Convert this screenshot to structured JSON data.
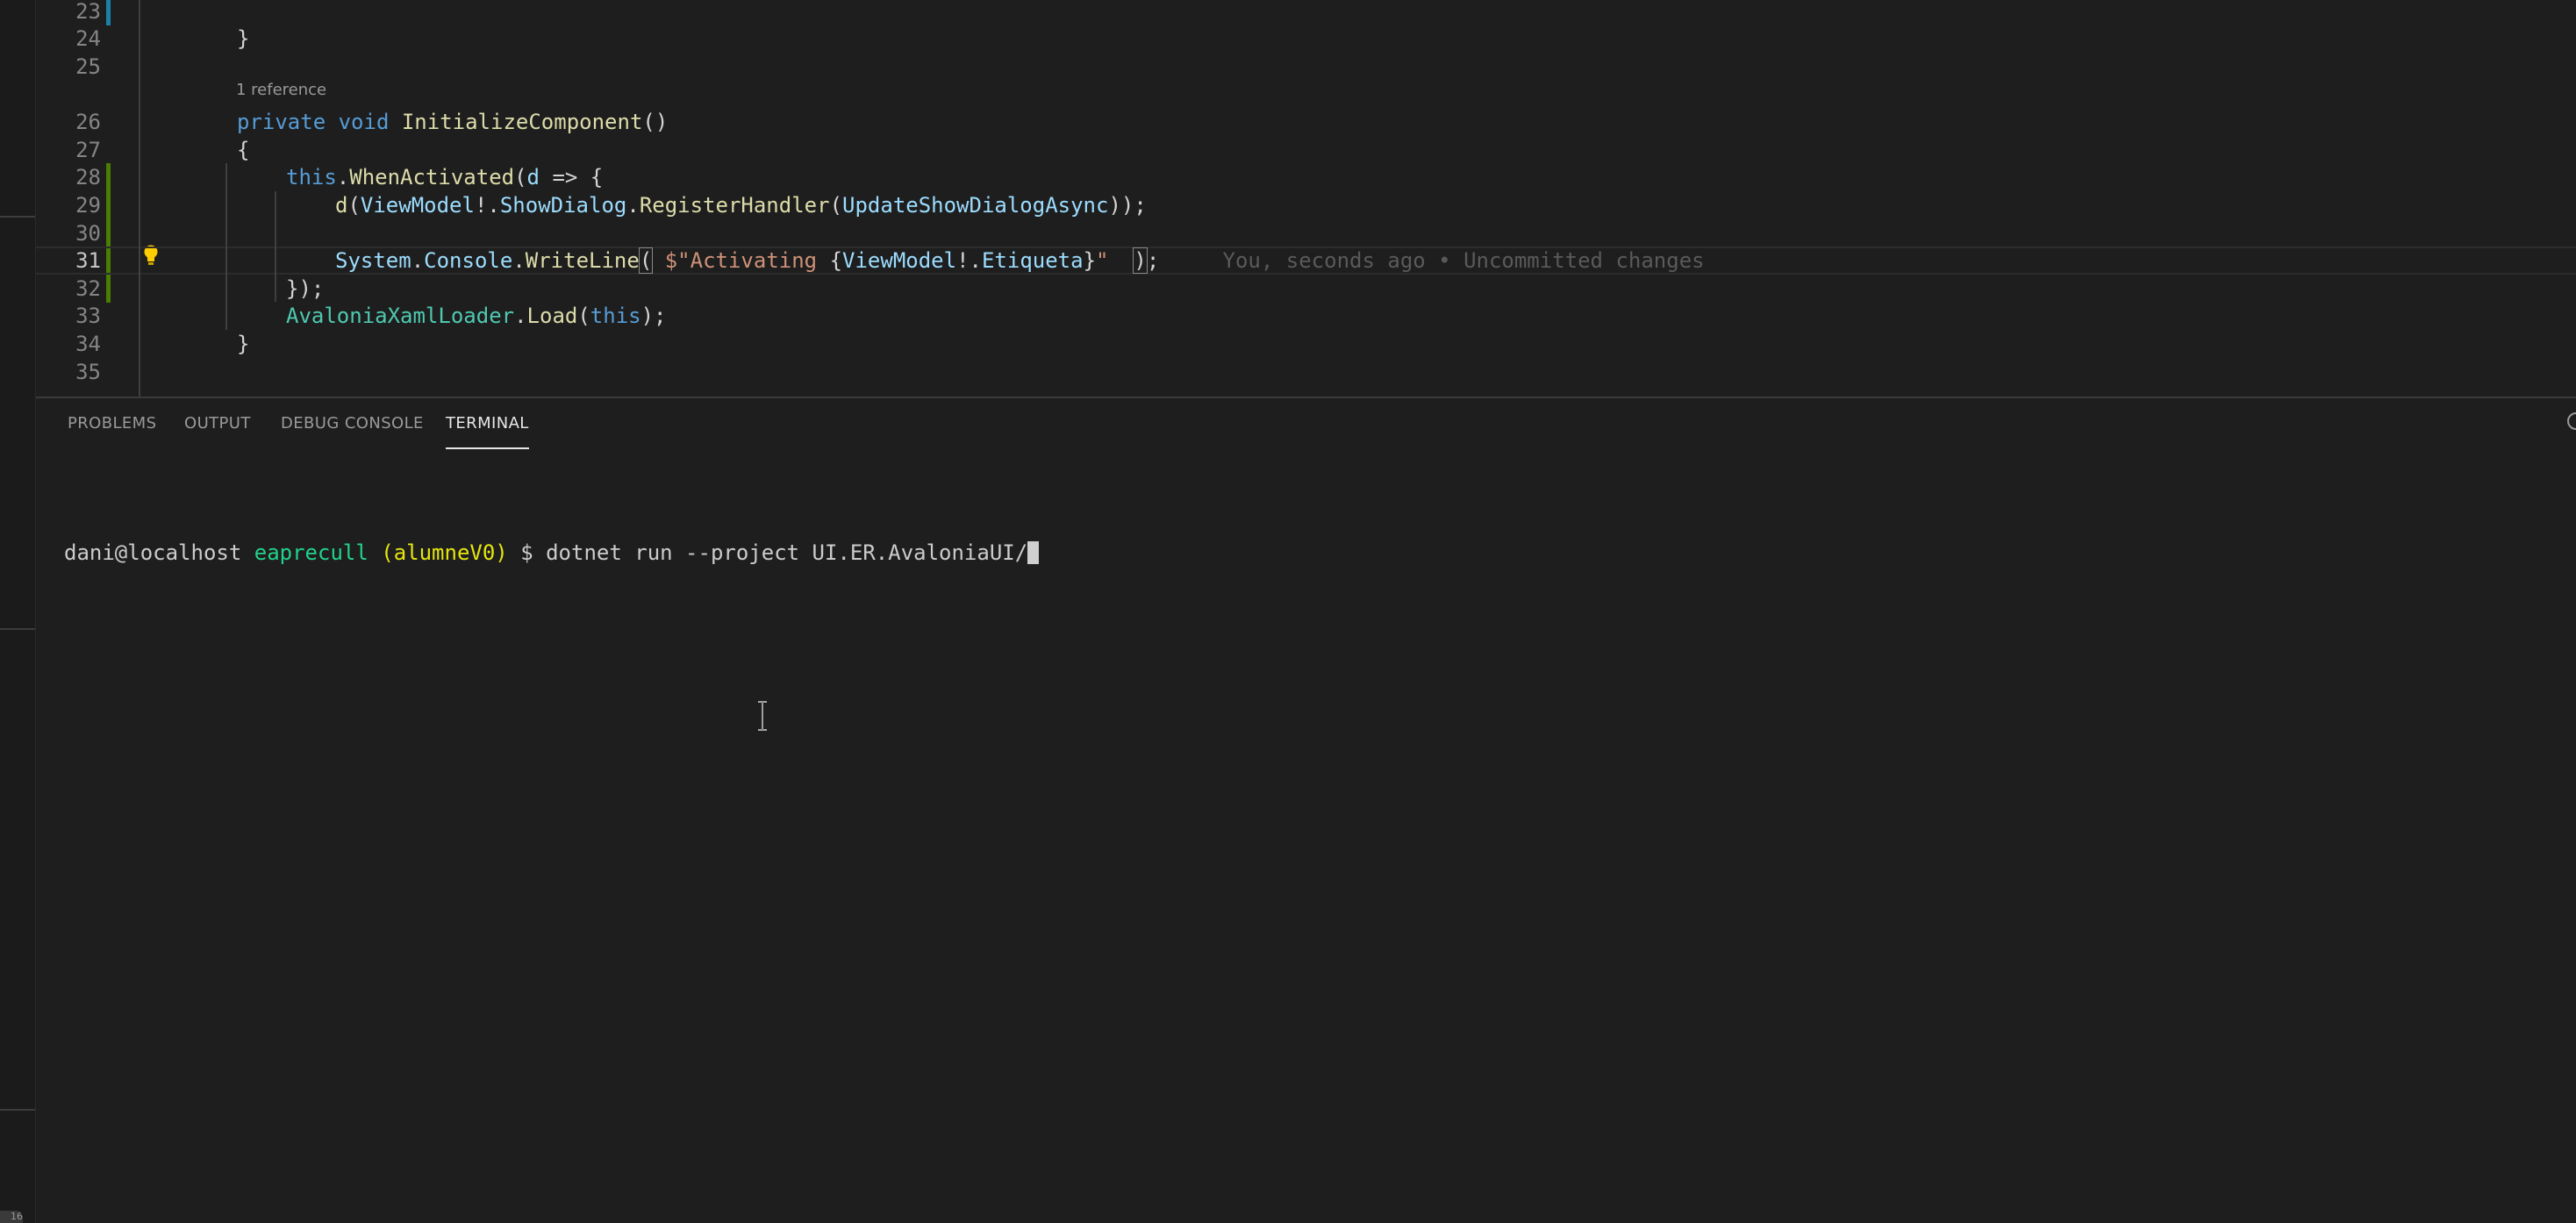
{
  "editor": {
    "codelens": "1 reference",
    "lines": [
      {
        "num": "23",
        "parts": []
      },
      {
        "num": "24",
        "parts": [
          {
            "text": "}",
            "cls": "p"
          }
        ]
      },
      {
        "num": "25",
        "parts": []
      },
      {
        "num": "26",
        "parts": [
          {
            "text": "private",
            "cls": "k"
          },
          {
            "text": " ",
            "cls": "p"
          },
          {
            "text": "void",
            "cls": "k"
          },
          {
            "text": " ",
            "cls": "p"
          },
          {
            "text": "InitializeComponent",
            "cls": "f"
          },
          {
            "text": "()",
            "cls": "p"
          }
        ]
      },
      {
        "num": "27",
        "parts": [
          {
            "text": "{",
            "cls": "p"
          }
        ]
      },
      {
        "num": "28",
        "parts": [
          {
            "text": "this",
            "cls": "k"
          },
          {
            "text": ".",
            "cls": "p"
          },
          {
            "text": "WhenActivated",
            "cls": "f"
          },
          {
            "text": "(",
            "cls": "p"
          },
          {
            "text": "d",
            "cls": "v"
          },
          {
            "text": " => {",
            "cls": "p"
          }
        ]
      },
      {
        "num": "29",
        "parts": [
          {
            "text": "d",
            "cls": "f"
          },
          {
            "text": "(",
            "cls": "p"
          },
          {
            "text": "ViewModel",
            "cls": "v"
          },
          {
            "text": "!.",
            "cls": "p"
          },
          {
            "text": "ShowDialog",
            "cls": "v"
          },
          {
            "text": ".",
            "cls": "p"
          },
          {
            "text": "RegisterHandler",
            "cls": "f"
          },
          {
            "text": "(",
            "cls": "p"
          },
          {
            "text": "UpdateShowDialogAsync",
            "cls": "v"
          },
          {
            "text": "));",
            "cls": "p"
          }
        ]
      },
      {
        "num": "30",
        "parts": []
      },
      {
        "num": "31",
        "parts": [
          {
            "text": "System",
            "cls": "v"
          },
          {
            "text": ".",
            "cls": "p"
          },
          {
            "text": "Console",
            "cls": "v"
          },
          {
            "text": ".",
            "cls": "p"
          },
          {
            "text": "WriteLine",
            "cls": "f"
          },
          {
            "text": "(",
            "cls": "bracket"
          },
          {
            "text": " ",
            "cls": "p"
          },
          {
            "text": "$\"Activating ",
            "cls": "s"
          },
          {
            "text": "{",
            "cls": "p"
          },
          {
            "text": "ViewModel",
            "cls": "v"
          },
          {
            "text": "!.",
            "cls": "p"
          },
          {
            "text": "Etiqueta",
            "cls": "v"
          },
          {
            "text": "}",
            "cls": "p"
          },
          {
            "text": "\"",
            "cls": "s"
          },
          {
            "text": "  ",
            "cls": "p"
          },
          {
            "text": ")",
            "cls": "bracket"
          },
          {
            "text": ";",
            "cls": "p"
          }
        ]
      },
      {
        "num": "32",
        "parts": [
          {
            "text": "});",
            "cls": "p"
          }
        ]
      },
      {
        "num": "33",
        "parts": [
          {
            "text": "AvaloniaXamlLoader",
            "cls": "t"
          },
          {
            "text": ".",
            "cls": "p"
          },
          {
            "text": "Load",
            "cls": "f"
          },
          {
            "text": "(",
            "cls": "p"
          },
          {
            "text": "this",
            "cls": "k"
          },
          {
            "text": ");",
            "cls": "p"
          }
        ]
      },
      {
        "num": "34",
        "parts": [
          {
            "text": "}",
            "cls": "p"
          }
        ]
      },
      {
        "num": "35",
        "parts": []
      }
    ],
    "blame": "You, seconds ago • Uncommitted changes"
  },
  "panel": {
    "tabs": [
      "PROBLEMS",
      "OUTPUT",
      "DEBUG CONSOLE",
      "TERMINAL"
    ],
    "active_tab": "TERMINAL"
  },
  "terminal": {
    "user_host": "dani@localhost",
    "directory": "eaprecull",
    "branch": "(alumneV0)",
    "prompt": "$",
    "command": "dotnet run --project UI.ER.AvaloniaUI/"
  },
  "misc": {
    "corner_badge": "16"
  }
}
